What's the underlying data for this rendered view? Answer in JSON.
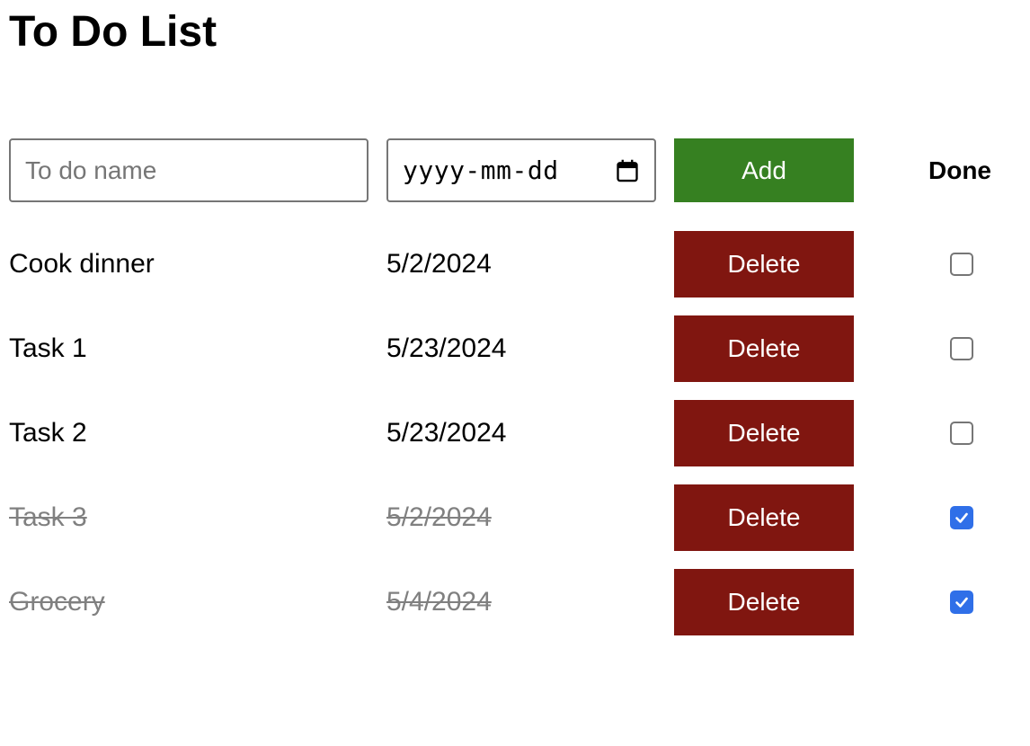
{
  "page": {
    "title": "To Do List"
  },
  "add_form": {
    "name_placeholder": "To do name",
    "name_value": "",
    "date_placeholder": "yyyy-mm-dd",
    "add_label": "Add",
    "done_header": "Done",
    "add_color": "#368021"
  },
  "todos": [
    {
      "name": "Cook dinner",
      "date": "5/2/2024",
      "delete_label": "Delete",
      "done": false
    },
    {
      "name": "Task 1",
      "date": "5/23/2024",
      "delete_label": "Delete",
      "done": false
    },
    {
      "name": "Task 2",
      "date": "5/23/2024",
      "delete_label": "Delete",
      "done": false
    },
    {
      "name": "Task 3",
      "date": "5/2/2024",
      "delete_label": "Delete",
      "done": true
    },
    {
      "name": "Grocery",
      "date": "5/4/2024",
      "delete_label": "Delete",
      "done": true
    }
  ],
  "colors": {
    "delete_button": "#801610",
    "checkbox_checked": "#2f6fe8",
    "done_text": "#808080"
  },
  "icons": {
    "date_picker": "calendar-icon",
    "checkbox_checked": "check-icon"
  }
}
